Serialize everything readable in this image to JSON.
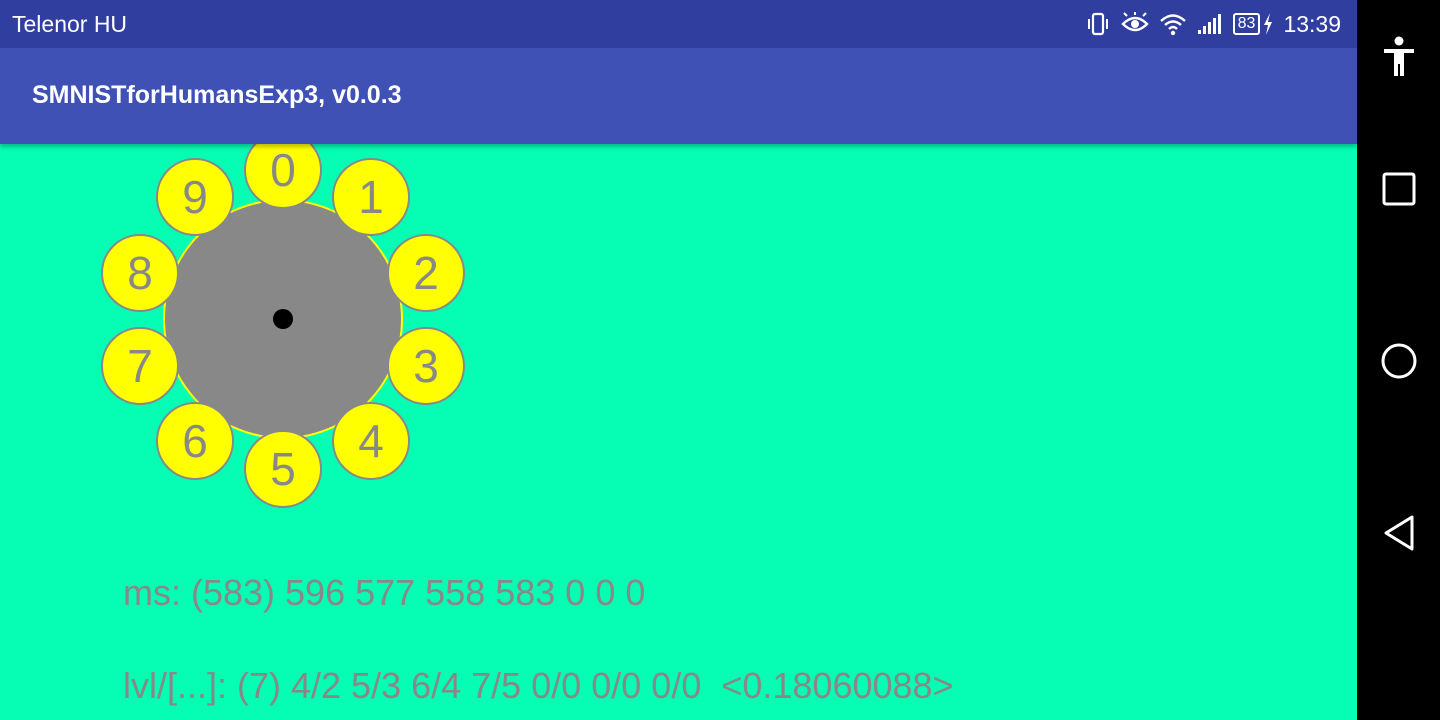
{
  "status_bar": {
    "carrier": "Telenor HU",
    "battery_level": "83",
    "time": "13:39",
    "icons": [
      "vibrate-icon",
      "eye-icon",
      "wifi-icon",
      "signal-icon",
      "battery-icon",
      "charging-icon"
    ]
  },
  "app_bar": {
    "title": "SMNISTforHumansExp3, v0.0.3"
  },
  "dial": {
    "digits": [
      "0",
      "1",
      "2",
      "3",
      "4",
      "5",
      "6",
      "7",
      "8",
      "9"
    ],
    "colors": {
      "disc": "#888888",
      "button": "#ffff00",
      "digit": "#888888",
      "center": "#000000"
    }
  },
  "info": {
    "ms_line": "ms: (583) 596 577 558 583 0 0 0",
    "lvl_line": "lvl/[...]: (7) 4/2 5/3 6/4 7/5 0/0 0/0 0/0  <0.18060088>"
  },
  "nav_bar": {
    "icons": [
      "accessibility-icon",
      "recents-icon",
      "home-icon",
      "back-icon"
    ]
  },
  "colors": {
    "background": "#06fdb4",
    "status_bar": "#303f9f",
    "app_bar": "#3f51b5"
  }
}
